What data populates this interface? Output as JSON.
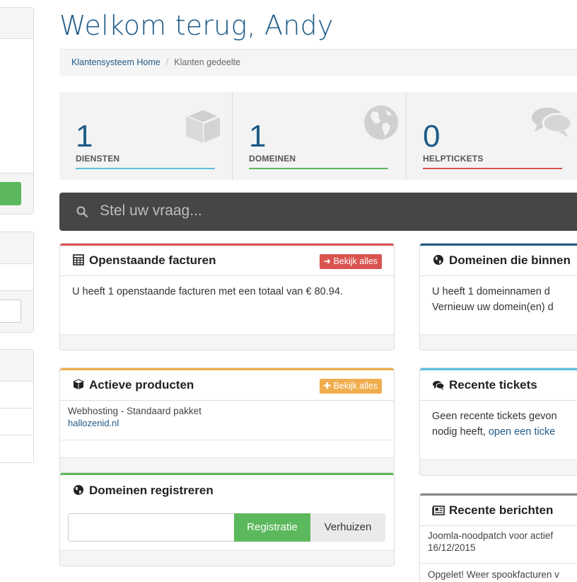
{
  "page": {
    "title": "Welkom terug, Andy"
  },
  "breadcrumb": {
    "home": "Klantensysteem Home",
    "separator": "/",
    "current": "Klanten gedeelte"
  },
  "tiles": [
    {
      "count": "1",
      "label": "DIENSTEN",
      "icon": "cube-icon",
      "color": "#5bc0de"
    },
    {
      "count": "1",
      "label": "DOMEINEN",
      "icon": "globe-icon",
      "color": "#5cb85c"
    },
    {
      "count": "0",
      "label": "HELPTICKETS",
      "icon": "comments-icon",
      "color": "#d9534f"
    }
  ],
  "search": {
    "placeholder": "Stel uw vraag..."
  },
  "panels": {
    "invoices": {
      "title": "Openstaande facturen",
      "button": "Bekijk alles",
      "text": "U heeft 1 openstaande facturen met een totaal van € 80.94.",
      "color": "#d9534f"
    },
    "products": {
      "title": "Actieve producten",
      "button": "Bekijk alles",
      "color": "#f0ad4e",
      "items": [
        {
          "name": "Webhosting - Standaard pakket",
          "domain": "hallozenid.nl"
        }
      ]
    },
    "register": {
      "title": "Domeinen registreren",
      "register_label": "Registratie",
      "transfer_label": "Verhuizen",
      "color": "#5cb85c"
    },
    "expiring": {
      "title": "Domeinen die binnen",
      "line1": "U heeft 1 domeinnamen d",
      "line2": "Vernieuw uw domein(en) d",
      "color": "#1d5a87"
    },
    "tickets": {
      "title": "Recente tickets",
      "line1": "Geen recente tickets gevon",
      "line2_prefix": "nodig heeft, ",
      "line2_link": "open een ticke",
      "color": "#5bc0de"
    },
    "news": {
      "title": "Recente berichten",
      "color": "#888888",
      "items": [
        {
          "title": "Joomla-noodpatch voor actief",
          "date": "16/12/2015"
        },
        {
          "title": "Opgelet! Weer spookfacturen v"
        }
      ]
    }
  }
}
